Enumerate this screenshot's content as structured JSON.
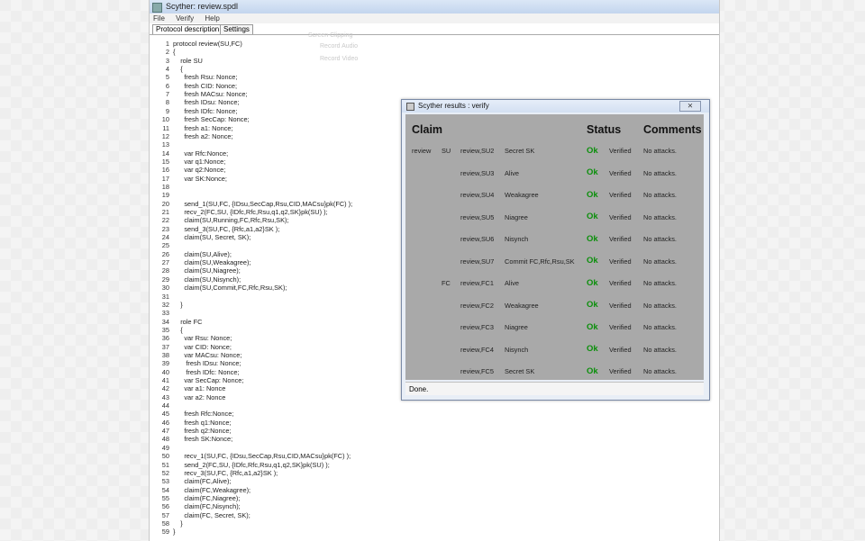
{
  "window": {
    "title": "Scyther: review.spdl"
  },
  "menu": [
    "File",
    "Verify",
    "Help"
  ],
  "tabs": [
    "Protocol description",
    "Settings"
  ],
  "ghost_ribbon": [
    "Screen Clipping",
    "Record Audio",
    "Record Video"
  ],
  "code": [
    {
      "n": "1",
      "t": "protocol review(SU,FC)"
    },
    {
      "n": "2",
      "t": "{"
    },
    {
      "n": "3",
      "t": "    role SU"
    },
    {
      "n": "4",
      "t": "    {"
    },
    {
      "n": "5",
      "t": "      fresh Rsu: Nonce;"
    },
    {
      "n": "6",
      "t": "      fresh CID: Nonce;"
    },
    {
      "n": "7",
      "t": "      fresh MACsu: Nonce;"
    },
    {
      "n": "8",
      "t": "      fresh IDsu: Nonce;"
    },
    {
      "n": "9",
      "t": "      fresh IDfc: Nonce;"
    },
    {
      "n": "10",
      "t": "      fresh SecCap: Nonce;"
    },
    {
      "n": "11",
      "t": "      fresh a1: Nonce;"
    },
    {
      "n": "12",
      "t": "      fresh a2: Nonce;"
    },
    {
      "n": "13",
      "t": ""
    },
    {
      "n": "14",
      "t": "      var Rfc:Nonce;"
    },
    {
      "n": "15",
      "t": "      var q1:Nonce;"
    },
    {
      "n": "16",
      "t": "      var q2:Nonce;"
    },
    {
      "n": "17",
      "t": "      var SK:Nonce;"
    },
    {
      "n": "18",
      "t": ""
    },
    {
      "n": "19",
      "t": ""
    },
    {
      "n": "20",
      "t": "      send_1(SU,FC, {IDsu,SecCap,Rsu,CID,MACsu}pk(FC) );"
    },
    {
      "n": "21",
      "t": "      recv_2(FC,SU, {IDfc,Rfc,Rsu,q1,q2,SK}pk(SU) );"
    },
    {
      "n": "22",
      "t": "      claim(SU,Running,FC,Rfc,Rsu,SK);"
    },
    {
      "n": "23",
      "t": "      send_3(SU,FC, {Rfc,a1,a2}SK );"
    },
    {
      "n": "24",
      "t": "      claim(SU, Secret, SK);"
    },
    {
      "n": "25",
      "t": ""
    },
    {
      "n": "26",
      "t": "      claim(SU,Alive);"
    },
    {
      "n": "27",
      "t": "      claim(SU,Weakagree);"
    },
    {
      "n": "28",
      "t": "      claim(SU,Niagree);"
    },
    {
      "n": "29",
      "t": "      claim(SU,Nisynch);"
    },
    {
      "n": "30",
      "t": "      claim(SU,Commit,FC,Rfc,Rsu,SK);"
    },
    {
      "n": "31",
      "t": ""
    },
    {
      "n": "32",
      "t": "    }"
    },
    {
      "n": "33",
      "t": ""
    },
    {
      "n": "34",
      "t": "    role FC"
    },
    {
      "n": "35",
      "t": "    {"
    },
    {
      "n": "36",
      "t": "      var Rsu: Nonce;"
    },
    {
      "n": "37",
      "t": "      var CID: Nonce;"
    },
    {
      "n": "38",
      "t": "      var MACsu: Nonce;"
    },
    {
      "n": "39",
      "t": "       fresh IDsu: Nonce;"
    },
    {
      "n": "40",
      "t": "       fresh IDfc: Nonce;"
    },
    {
      "n": "41",
      "t": "      var SecCap: Nonce;"
    },
    {
      "n": "42",
      "t": "      var a1: Nonce"
    },
    {
      "n": "43",
      "t": "      var a2: Nonce"
    },
    {
      "n": "44",
      "t": ""
    },
    {
      "n": "45",
      "t": "      fresh Rfc:Nonce;"
    },
    {
      "n": "46",
      "t": "      fresh q1:Nonce;"
    },
    {
      "n": "47",
      "t": "      fresh q2:Nonce;"
    },
    {
      "n": "48",
      "t": "      fresh SK:Nonce;"
    },
    {
      "n": "49",
      "t": ""
    },
    {
      "n": "50",
      "t": "      recv_1(SU,FC, {IDsu,SecCap,Rsu,CID,MACsu}pk(FC) );"
    },
    {
      "n": "51",
      "t": "      send_2(FC,SU, {IDfc,Rfc,Rsu,q1,q2,SK}pk(SU) );"
    },
    {
      "n": "52",
      "t": "      recv_3(SU,FC, {Rfc,a1,a2}SK );"
    },
    {
      "n": "53",
      "t": "      claim(FC,Alive);"
    },
    {
      "n": "54",
      "t": "      claim(FC,Weakagree);"
    },
    {
      "n": "55",
      "t": "      claim(FC,Niagree);"
    },
    {
      "n": "56",
      "t": "      claim(FC,Nisynch);"
    },
    {
      "n": "57",
      "t": "      claim(FC, Secret, SK);"
    },
    {
      "n": "58",
      "t": "    }"
    },
    {
      "n": "59",
      "t": "}"
    }
  ],
  "results": {
    "title": "Scyther results : verify",
    "close": "⨯",
    "headers": {
      "claim": "Claim",
      "status": "Status",
      "comments": "Comments"
    },
    "rows": [
      {
        "protocol": "review",
        "role": "SU",
        "id": "review,SU2",
        "claim": "Secret SK",
        "ok": "Ok",
        "verdict": "Verified",
        "comment": "No attacks."
      },
      {
        "protocol": "",
        "role": "",
        "id": "review,SU3",
        "claim": "Alive",
        "ok": "Ok",
        "verdict": "Verified",
        "comment": "No attacks."
      },
      {
        "protocol": "",
        "role": "",
        "id": "review,SU4",
        "claim": "Weakagree",
        "ok": "Ok",
        "verdict": "Verified",
        "comment": "No attacks."
      },
      {
        "protocol": "",
        "role": "",
        "id": "review,SU5",
        "claim": "Niagree",
        "ok": "Ok",
        "verdict": "Verified",
        "comment": "No attacks."
      },
      {
        "protocol": "",
        "role": "",
        "id": "review,SU6",
        "claim": "Nisynch",
        "ok": "Ok",
        "verdict": "Verified",
        "comment": "No attacks."
      },
      {
        "protocol": "",
        "role": "",
        "id": "review,SU7",
        "claim": "Commit FC,Rfc,Rsu,SK",
        "ok": "Ok",
        "verdict": "Verified",
        "comment": "No attacks."
      },
      {
        "protocol": "",
        "role": "FC",
        "id": "review,FC1",
        "claim": "Alive",
        "ok": "Ok",
        "verdict": "Verified",
        "comment": "No attacks."
      },
      {
        "protocol": "",
        "role": "",
        "id": "review,FC2",
        "claim": "Weakagree",
        "ok": "Ok",
        "verdict": "Verified",
        "comment": "No attacks."
      },
      {
        "protocol": "",
        "role": "",
        "id": "review,FC3",
        "claim": "Niagree",
        "ok": "Ok",
        "verdict": "Verified",
        "comment": "No attacks."
      },
      {
        "protocol": "",
        "role": "",
        "id": "review,FC4",
        "claim": "Nisynch",
        "ok": "Ok",
        "verdict": "Verified",
        "comment": "No attacks."
      },
      {
        "protocol": "",
        "role": "",
        "id": "review,FC5",
        "claim": "Secret SK",
        "ok": "Ok",
        "verdict": "Verified",
        "comment": "No attacks."
      }
    ],
    "status": "Done."
  },
  "colors": {
    "ok": "#0b8f0b",
    "grid_bg": "#a9a9a9"
  }
}
